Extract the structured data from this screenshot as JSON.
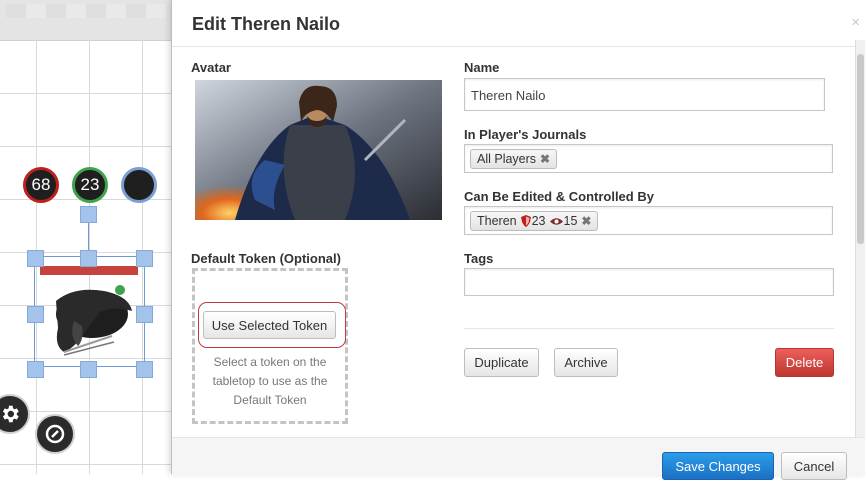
{
  "tabletop": {
    "bubbles": [
      "68",
      "23",
      ""
    ]
  },
  "dialog": {
    "title": "Edit Theren Nailo",
    "close": "×",
    "avatar_label": "Avatar",
    "default_token_label": "Default Token (Optional)",
    "use_selected_token": "Use Selected Token",
    "token_hint_line1": "Select a token on the",
    "token_hint_line2": "tabletop to use as the",
    "token_hint_line3": "Default Token",
    "name_label": "Name",
    "name_value": "Theren Nailo",
    "journals_label": "In Player's Journals",
    "journals_chip": "All Players",
    "controlled_label": "Can Be Edited & Controlled By",
    "controlled_chip_name": "Theren",
    "controlled_chip_stat1": "23",
    "controlled_chip_stat2": "15",
    "tags_label": "Tags",
    "tags_value": "",
    "duplicate": "Duplicate",
    "archive": "Archive",
    "delete": "Delete",
    "save": "Save Changes",
    "cancel": "Cancel"
  },
  "colors": {
    "delete_red": "#d9534f",
    "save_blue": "#1f82d8",
    "bubble_red": "#c0201c",
    "bubble_green": "#3fa34d",
    "bubble_blue": "#7a9fd0"
  }
}
